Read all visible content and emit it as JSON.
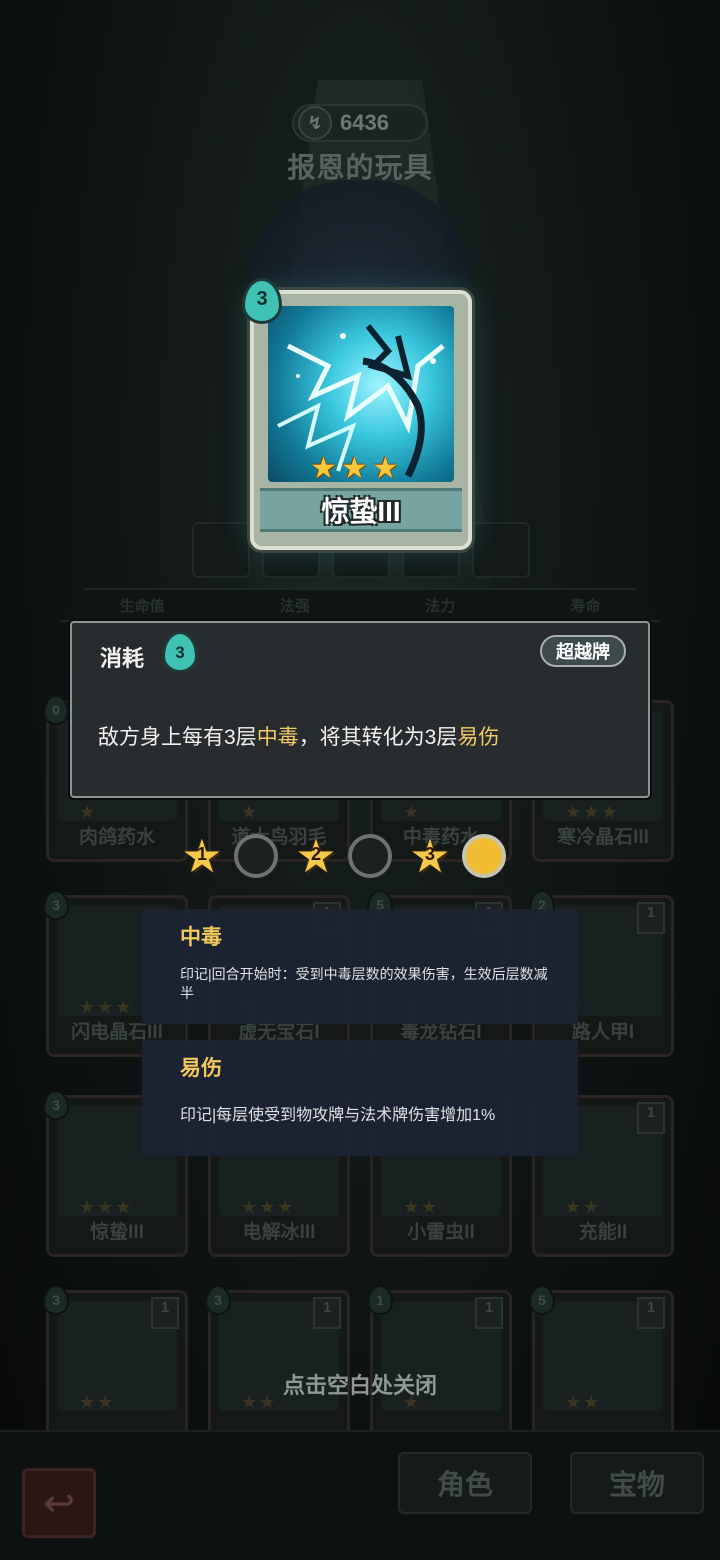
{
  "header": {
    "power_value": "6436",
    "character_title": "报恩的玩具"
  },
  "featured_card": {
    "name": "惊蛰III",
    "cost": "3",
    "stars": 3
  },
  "stats_labels": [
    "生命值",
    "法强",
    "法力",
    "寿命"
  ],
  "grid_cards": [
    {
      "name": "肉鸽药水",
      "cost": "0",
      "count": "",
      "stars": 1
    },
    {
      "name": "道士鸟羽毛",
      "cost": "",
      "count": "",
      "stars": 1
    },
    {
      "name": "中毒药水",
      "cost": "",
      "count": "",
      "stars": 1
    },
    {
      "name": "寒冷晶石III",
      "cost": "",
      "count": "",
      "stars": 3
    },
    {
      "name": "闪电晶石III",
      "cost": "3",
      "count": "",
      "stars": 3
    },
    {
      "name": "虚无宝石I",
      "cost": "",
      "count": "1",
      "stars": 1
    },
    {
      "name": "毒龙钻石I",
      "cost": "5",
      "count": "1",
      "stars": 1
    },
    {
      "name": "路人甲I",
      "cost": "2",
      "count": "1",
      "stars": 1
    },
    {
      "name": "惊蛰III",
      "cost": "3",
      "count": "",
      "stars": 3
    },
    {
      "name": "电解冰III",
      "cost": "",
      "count": "",
      "stars": 3
    },
    {
      "name": "小雷虫II",
      "cost": "",
      "count": "",
      "stars": 2
    },
    {
      "name": "充能II",
      "cost": "",
      "count": "1",
      "stars": 2
    },
    {
      "name": "",
      "cost": "3",
      "count": "1",
      "stars": 2
    },
    {
      "name": "",
      "cost": "3",
      "count": "1",
      "stars": 2
    },
    {
      "name": "",
      "cost": "1",
      "count": "1",
      "stars": 1
    },
    {
      "name": "",
      "cost": "5",
      "count": "1",
      "stars": 2
    }
  ],
  "popup": {
    "cost_label": "消耗",
    "cost_value": "3",
    "tag_label": "超越牌",
    "desc_prefix": "敌方身上每有3层",
    "desc_kw1": "中毒",
    "desc_mid": "，将其转化为3层",
    "desc_kw2": "易伤"
  },
  "levels": [
    {
      "num": "1",
      "selected": false
    },
    {
      "num": "2",
      "selected": false
    },
    {
      "num": "3",
      "selected": true
    }
  ],
  "keywords": [
    {
      "title": "中毒",
      "desc": "印记|回合开始时：受到中毒层数的效果伤害，生效后层数减半"
    },
    {
      "title": "易伤",
      "desc": "印记|每层使受到物攻牌与法术牌伤害增加1%"
    }
  ],
  "close_hint": "点击空白处关闭",
  "bottom_tabs": {
    "role": "角色",
    "treasure": "宝物"
  },
  "colors": {
    "highlight": "#f3cb62",
    "selected_level": "#f0bd32"
  }
}
